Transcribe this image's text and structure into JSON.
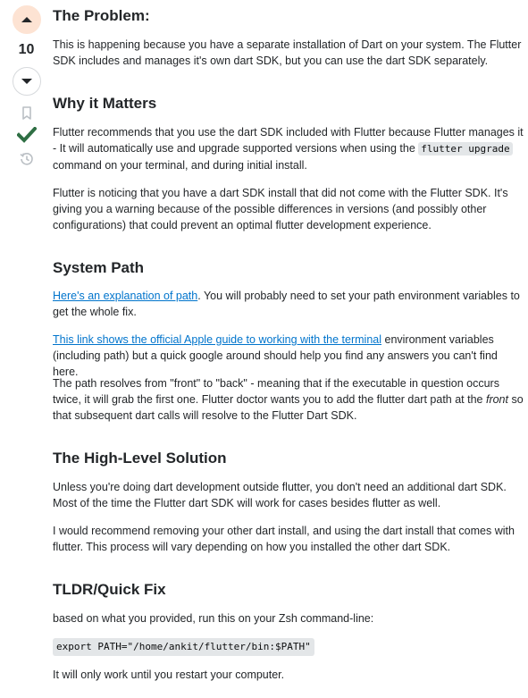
{
  "votes": {
    "count": "10"
  },
  "sections": {
    "problem": {
      "heading": "The Problem:",
      "p1": "This is happening because you have a separate installation of Dart on your system. The Flutter SDK includes and manages it's own dart SDK, but you can use the dart SDK separately."
    },
    "why": {
      "heading": "Why it Matters",
      "p1_before": "Flutter recommends that you use the dart SDK included with Flutter because Flutter manages it - It will automatically use and upgrade supported versions when using the ",
      "p1_code": "flutter upgrade",
      "p1_after": " command on your terminal, and during initial install.",
      "p2": "Flutter is noticing that you have a dart SDK install that did not come with the Flutter SDK. It's giving you a warning because of the possible differences in versions (and possibly other configurations) that could prevent an optimal flutter development experience."
    },
    "path": {
      "heading": "System Path",
      "p1_link": "Here's an explanation of path",
      "p1_after": ". You will probably need to set your path environment variables to get the whole fix.",
      "p2_link": "This link shows the official Apple guide to working with the terminal",
      "p2_after": " environment variables (including path) but a quick google around should help you find any answers you can't find here.",
      "p3_before": "The path resolves from \"front\" to \"back\" - meaning that if the executable in question occurs twice, it will grab the first one. Flutter doctor wants you to add the flutter dart path at the ",
      "p3_em": "front",
      "p3_after": " so that subsequent dart calls will resolve to the Flutter Dart SDK."
    },
    "solution": {
      "heading": "The High-Level Solution",
      "p1": "Unless you're doing dart development outside flutter, you don't need an additional dart SDK. Most of the time the Flutter dart SDK will work for cases besides flutter as well.",
      "p2": "I would recommend removing your other dart install, and using the dart install that comes with flutter. This process will vary depending on how you installed the other dart SDK."
    },
    "tldr": {
      "heading": "TLDR/Quick Fix",
      "p1": "based on what you provided, run this on your Zsh command-line:",
      "code": "export PATH=\"/home/ankit/flutter/bin:$PATH\"",
      "p2": "It will only work until you restart your computer."
    }
  },
  "colors": {
    "upvote_active_bg": "#fde3d3",
    "accepted_check": "#2f6f44",
    "link": "#0074cc"
  },
  "icons": [
    "upvote-arrow-icon",
    "downvote-arrow-icon",
    "bookmark-icon",
    "accepted-check-icon",
    "history-icon"
  ]
}
